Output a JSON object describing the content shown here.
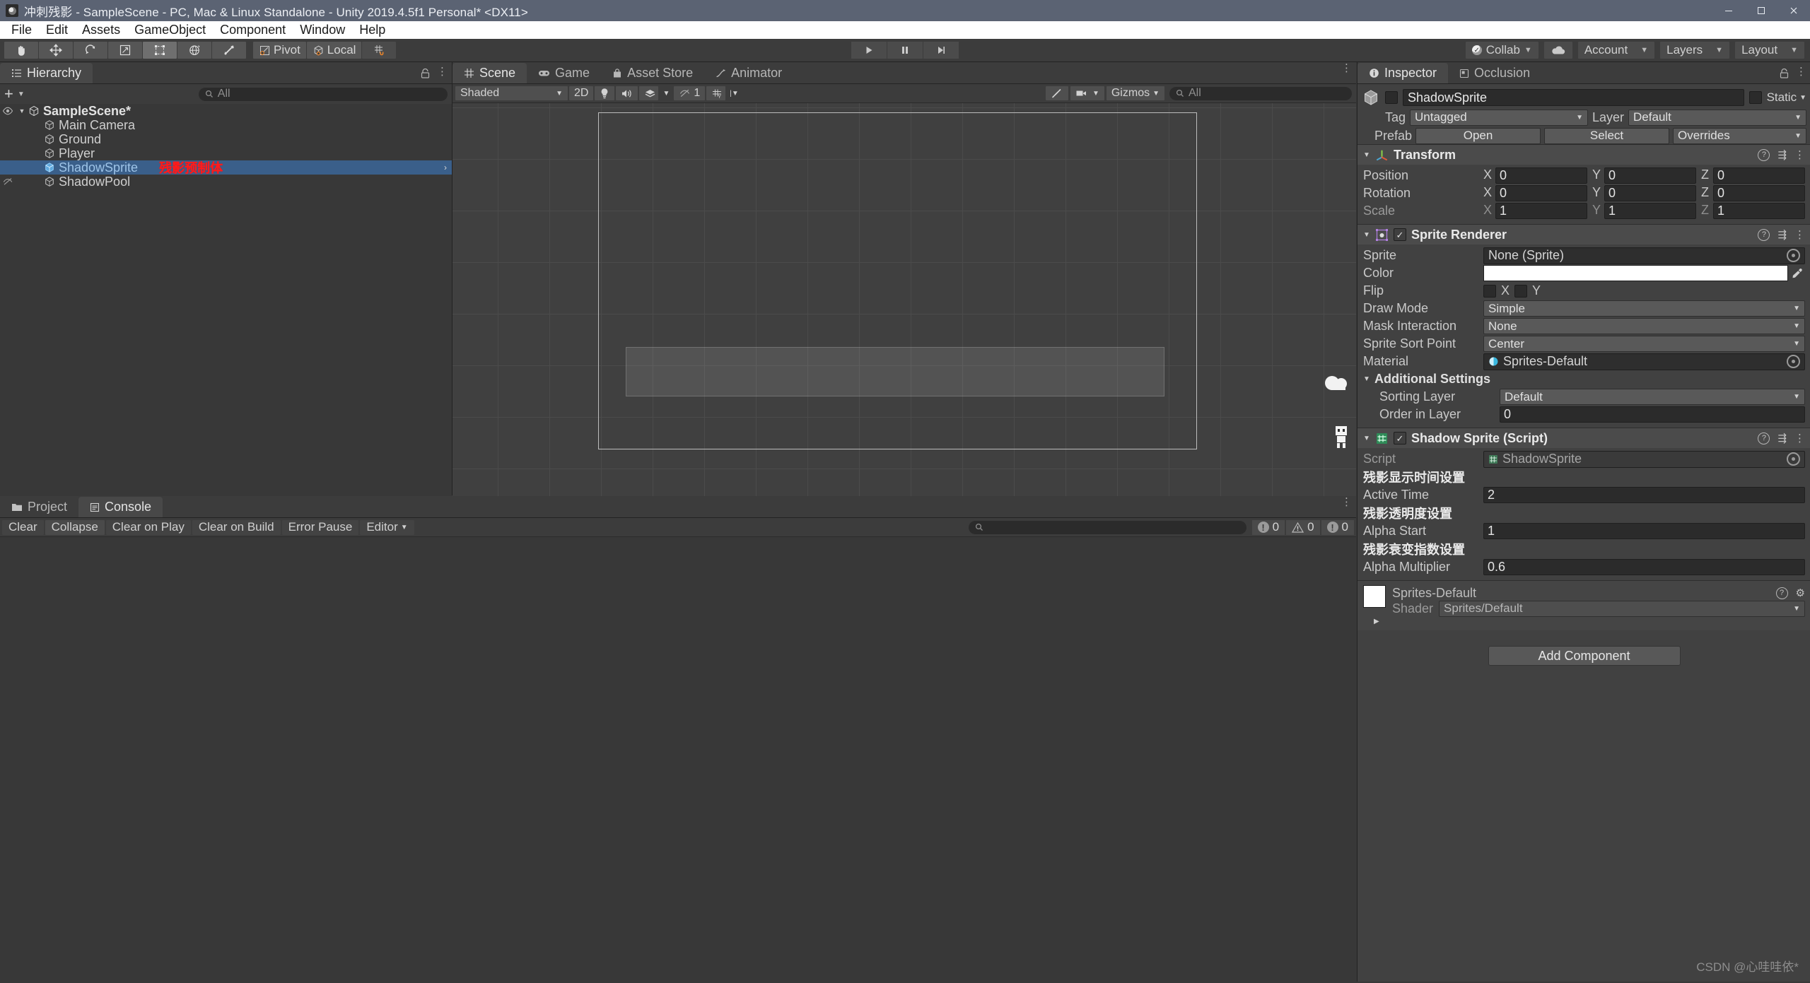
{
  "window": {
    "title": "冲刺残影 - SampleScene - PC, Mac & Linux Standalone - Unity 2019.4.5f1 Personal* <DX11>",
    "icon": "unity-icon",
    "minimize": "minimize-icon",
    "maximize": "maximize-icon",
    "close": "close-icon"
  },
  "menubar": {
    "items": [
      "File",
      "Edit",
      "Assets",
      "GameObject",
      "Component",
      "Window",
      "Help"
    ]
  },
  "toolbar": {
    "tools": [
      "hand-tool",
      "move-tool",
      "rotate-tool",
      "scale-tool",
      "rect-tool",
      "transform-tool",
      "custom-tool"
    ],
    "snap_icon": "grid-snap-icon",
    "pivot_label": "Pivot",
    "local_label": "Local",
    "play": "play-icon",
    "pause": "pause-icon",
    "step": "step-icon",
    "collab_label": "Collab",
    "cloud_label": "cloud-icon",
    "account_label": "Account",
    "layers_label": "Layers",
    "layout_label": "Layout"
  },
  "hierarchy": {
    "tab": "Hierarchy",
    "create_label": "+",
    "search_placeholder": "All",
    "rows": [
      {
        "label": "SampleScene*",
        "depth": 0,
        "icon": "scene-icon",
        "selected": false,
        "bold": true,
        "eye": true,
        "expander": "▼"
      },
      {
        "label": "Main Camera",
        "depth": 1,
        "icon": "gameobject-icon",
        "selected": false
      },
      {
        "label": "Ground",
        "depth": 1,
        "icon": "gameobject-icon",
        "selected": false
      },
      {
        "label": "Player",
        "depth": 1,
        "icon": "gameobject-icon",
        "selected": false
      },
      {
        "label": "ShadowSprite",
        "depth": 1,
        "icon": "prefab-icon",
        "selected": true,
        "annotation": "残影预制体",
        "arrow": "›"
      },
      {
        "label": "ShadowPool",
        "depth": 1,
        "icon": "gameobject-icon",
        "selected": false,
        "eye_off": true
      }
    ]
  },
  "scene": {
    "tabs": [
      {
        "label": "Scene",
        "icon": "scene-grid-icon",
        "active": true
      },
      {
        "label": "Game",
        "icon": "gamepad-icon",
        "active": false
      },
      {
        "label": "Asset Store",
        "icon": "store-icon",
        "active": false
      },
      {
        "label": "Animator",
        "icon": "animator-icon",
        "active": false
      }
    ],
    "draw_mode": "Shaded",
    "mode_2d": "2D",
    "lighting_icon": "lightbulb-icon",
    "audio_icon": "speaker-icon",
    "fx_icon": "effects-icon",
    "hidden_count": "1",
    "grid_icon": "grid-icon",
    "gizmos_label": "Gizmos",
    "gizmo_search_placeholder": "All",
    "tools_icon": "wrench-icon",
    "camera_icon": "camera-icon"
  },
  "inspector": {
    "tabs": [
      {
        "label": "Inspector",
        "icon": "info-icon",
        "active": true
      },
      {
        "label": "Occlusion",
        "icon": "occlusion-icon",
        "active": false
      }
    ],
    "lock_icon": "lock-icon",
    "menu_icon": "kebab-menu-icon",
    "gameobject": {
      "name": "ShadowSprite",
      "enabled": false,
      "static_label": "Static",
      "static_checked": false,
      "tag_label": "Tag",
      "tag_value": "Untagged",
      "layer_label": "Layer",
      "layer_value": "Default",
      "prefab_label": "Prefab",
      "prefab_open": "Open",
      "prefab_select": "Select",
      "prefab_overrides": "Overrides"
    },
    "transform": {
      "title": "Transform",
      "icon": "transform-icon",
      "rows": [
        {
          "label": "Position",
          "x": "0",
          "y": "0",
          "z": "0",
          "dim": false
        },
        {
          "label": "Rotation",
          "x": "0",
          "y": "0",
          "z": "0",
          "dim": false
        },
        {
          "label": "Scale",
          "x": "1",
          "y": "1",
          "z": "1",
          "dim": true
        }
      ]
    },
    "sprite_renderer": {
      "title": "Sprite Renderer",
      "icon": "sprite-renderer-icon",
      "enabled": true,
      "sprite_label": "Sprite",
      "sprite_value": "None (Sprite)",
      "color_label": "Color",
      "color_value": "#FFFFFF",
      "flip_label": "Flip",
      "flip_x": "X",
      "flip_y": "Y",
      "draw_mode_label": "Draw Mode",
      "draw_mode_value": "Simple",
      "mask_label": "Mask Interaction",
      "mask_value": "None",
      "sort_point_label": "Sprite Sort Point",
      "sort_point_value": "Center",
      "material_label": "Material",
      "material_value": "Sprites-Default",
      "additional_label": "Additional Settings",
      "sorting_layer_label": "Sorting Layer",
      "sorting_layer_value": "Default",
      "order_label": "Order in Layer",
      "order_value": "0"
    },
    "shadow_script": {
      "title": "Shadow Sprite (Script)",
      "icon": "cs-script-icon",
      "enabled": true,
      "script_label": "Script",
      "script_value": "ShadowSprite",
      "groups": [
        {
          "header": "残影显示时间设置",
          "label": "Active Time",
          "value": "2"
        },
        {
          "header": "残影透明度设置",
          "label": "Alpha Start",
          "value": "1"
        },
        {
          "header": "残影衰变指数设置",
          "label": "Alpha Multiplier",
          "value": "0.6"
        }
      ]
    },
    "material_preview": {
      "title": "Sprites-Default",
      "shader_label": "Shader",
      "shader_value": "Sprites/Default",
      "help_icon": "help-icon",
      "gear_icon": "gear-icon"
    },
    "add_component": "Add Component"
  },
  "console": {
    "tabs": [
      {
        "label": "Project",
        "icon": "folder-icon",
        "active": false
      },
      {
        "label": "Console",
        "icon": "console-icon",
        "active": true
      }
    ],
    "buttons": [
      "Clear",
      "Collapse",
      "Clear on Play",
      "Clear on Build",
      "Error Pause"
    ],
    "editor_dropdown": "Editor",
    "search_placeholder": "",
    "counts": [
      {
        "icon": "error-icon",
        "value": "0"
      },
      {
        "icon": "warning-icon",
        "value": "0"
      },
      {
        "icon": "info-icon",
        "value": "0"
      }
    ]
  },
  "watermark": "CSDN @心哇哇依*"
}
